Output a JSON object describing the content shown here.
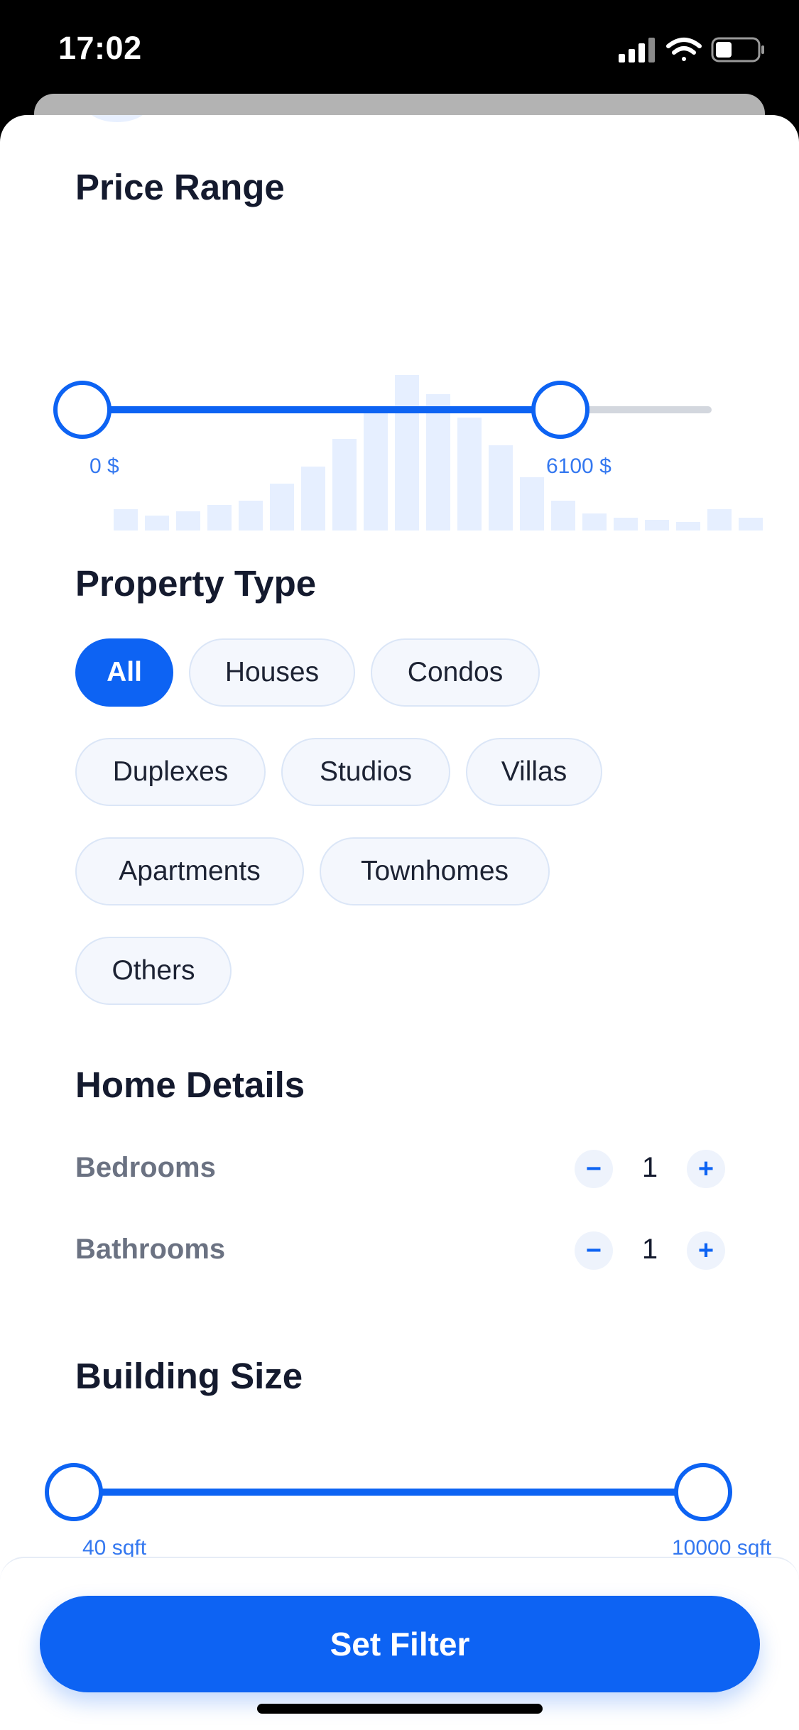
{
  "status_bar": {
    "time": "17:02"
  },
  "price_range": {
    "title": "Price Range",
    "min_label": "0 $",
    "max_label": "6100 $",
    "min_fraction": 0.0,
    "max_fraction": 0.76,
    "histogram_fractions": [
      0.1,
      0.07,
      0.09,
      0.12,
      0.14,
      0.22,
      0.3,
      0.43,
      0.55,
      0.73,
      0.64,
      0.53,
      0.4,
      0.25,
      0.14,
      0.08,
      0.06,
      0.05,
      0.04,
      0.1,
      0.06
    ]
  },
  "property_type": {
    "title": "Property Type",
    "options": [
      "All",
      "Houses",
      "Condos",
      "Duplexes",
      "Studios",
      "Villas",
      "Apartments",
      "Townhomes",
      "Others"
    ],
    "selected": "All"
  },
  "home_details": {
    "title": "Home Details",
    "bedrooms": {
      "label": "Bedrooms",
      "value": "1",
      "minus": "−",
      "plus": "+"
    },
    "bathrooms": {
      "label": "Bathrooms",
      "value": "1",
      "minus": "−",
      "plus": "+"
    }
  },
  "building_size": {
    "title": "Building Size",
    "min_label": "40 sqft",
    "max_label": "10000 sqft",
    "min_fraction": 0.0,
    "max_fraction": 1.0
  },
  "actions": {
    "set_filter": "Set Filter"
  },
  "colors": {
    "accent": "#0d63f3",
    "track_inactive": "#d3d7de",
    "histogram": "#e6efff",
    "label": "#3478f0"
  }
}
